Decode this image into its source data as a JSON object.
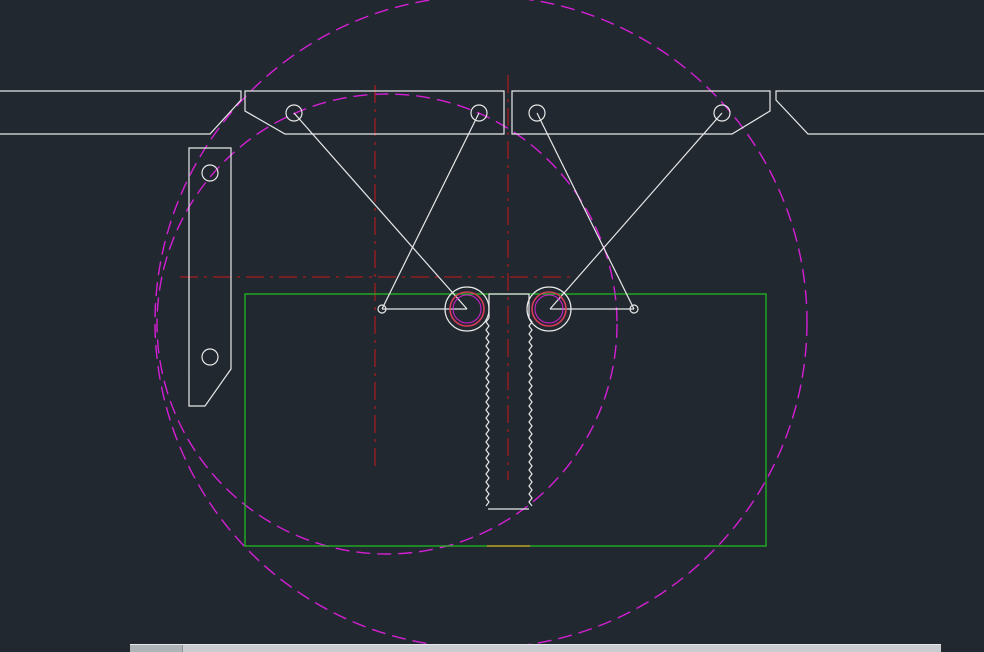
{
  "app": {
    "background_color": "#212830"
  },
  "colors": {
    "geometry": "#e8e8e8",
    "construction_circle": "#d41fd4",
    "centerline": "#c81818",
    "boundary_box": "#22c51f",
    "thread_marker": "#d83a5a"
  },
  "command_line": {
    "prompt_text": "",
    "handle_icon": "grip-handle-icon"
  }
}
